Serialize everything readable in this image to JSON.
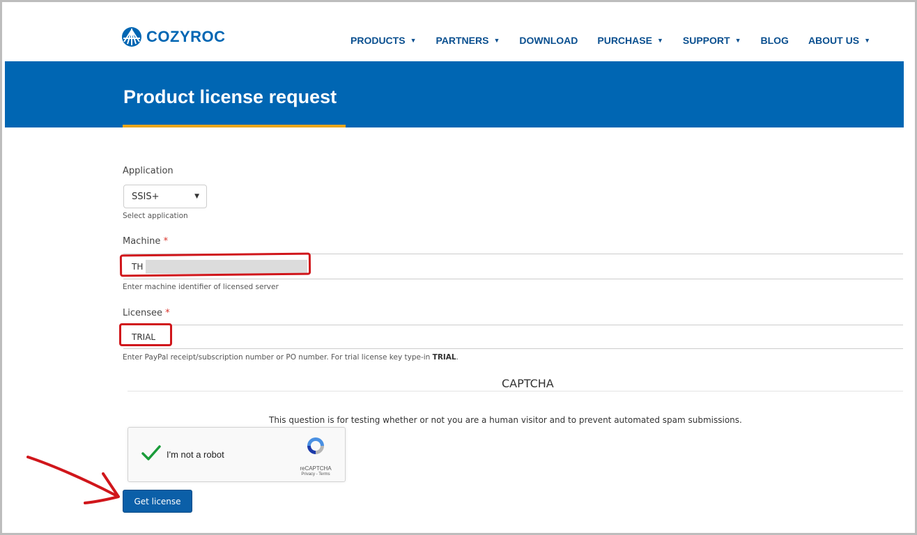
{
  "brand": {
    "name": "COZYROC"
  },
  "nav": {
    "items": [
      {
        "label": "PRODUCTS",
        "has_caret": true
      },
      {
        "label": "PARTNERS",
        "has_caret": true
      },
      {
        "label": "DOWNLOAD",
        "has_caret": false
      },
      {
        "label": "PURCHASE",
        "has_caret": true
      },
      {
        "label": "SUPPORT",
        "has_caret": true
      },
      {
        "label": "BLOG",
        "has_caret": false
      },
      {
        "label": "ABOUT US",
        "has_caret": true
      }
    ]
  },
  "banner": {
    "title": "Product license request"
  },
  "form": {
    "application": {
      "label": "Application",
      "value": "SSIS+",
      "help": "Select application"
    },
    "machine": {
      "label": "Machine",
      "required_mark": "*",
      "value": "TH",
      "help": "Enter machine identifier of licensed server"
    },
    "licensee": {
      "label": "Licensee",
      "required_mark": "*",
      "value": "TRIAL",
      "help_prefix": "Enter PayPal receipt/subscription number or PO number. For trial license key type-in ",
      "help_bold": "TRIAL",
      "help_suffix": "."
    }
  },
  "captcha": {
    "title": "CAPTCHA",
    "description": "This question is for testing whether or not you are a human visitor and to prevent automated spam submissions.",
    "checkbox_label": "I'm not a robot",
    "brand": "reCAPTCHA",
    "links": "Privacy - Terms"
  },
  "submit": {
    "label": "Get license"
  },
  "colors": {
    "brand_blue": "#0066b3",
    "accent_orange": "#e8a51b",
    "annotation_red": "#d0161b",
    "button_blue": "#0b5fa8"
  }
}
